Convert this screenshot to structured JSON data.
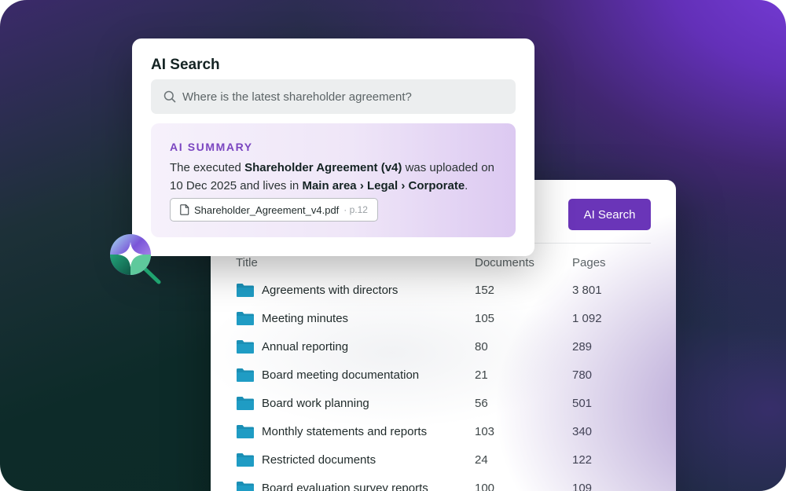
{
  "search_card": {
    "title": "AI Search",
    "search_placeholder": "Where is the latest shareholder agreement?",
    "summary": {
      "label": "AI SUMMARY",
      "text_1": "The executed ",
      "doc_name": "Shareholder Agreement (v4)",
      "text_2": " was uploaded on 10 Dec 2025 and lives in ",
      "location": "Main area › Legal › Corporate",
      "text_3": ".",
      "file": {
        "name": "Shareholder_Agreement_v4.pdf",
        "page_ref": "· p.12"
      }
    }
  },
  "folder_panel": {
    "ai_button_label": "AI Search",
    "columns": {
      "title": "Title",
      "documents": "Documents",
      "pages": "Pages"
    },
    "rows": [
      {
        "title": "Agreements with directors",
        "documents": "152",
        "pages": "3 801"
      },
      {
        "title": "Meeting minutes",
        "documents": "105",
        "pages": "1 092"
      },
      {
        "title": "Annual reporting",
        "documents": "80",
        "pages": "289"
      },
      {
        "title": "Board meeting documentation",
        "documents": "21",
        "pages": "780"
      },
      {
        "title": "Board work planning",
        "documents": "56",
        "pages": "501"
      },
      {
        "title": "Monthly statements and reports",
        "documents": "103",
        "pages": "340"
      },
      {
        "title": "Restricted documents",
        "documents": "24",
        "pages": "122"
      },
      {
        "title": "Board evaluation survey reports",
        "documents": "100",
        "pages": "109"
      }
    ]
  },
  "icons": {
    "folder": "folder-icon",
    "search": "search-icon",
    "file": "file-icon",
    "magnifier": "ai-magnifier-icon"
  },
  "colors": {
    "accent": "#6a35b8",
    "summary_label": "#7a45c0",
    "folder": "#1a8fb5"
  }
}
